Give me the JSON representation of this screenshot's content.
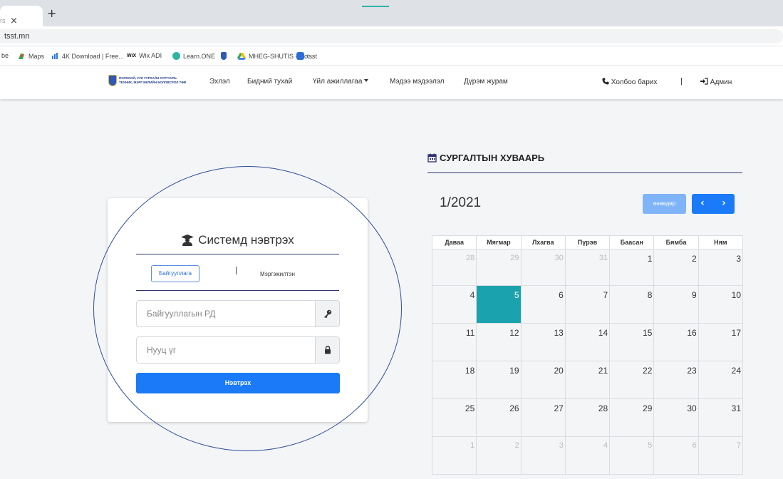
{
  "browser": {
    "tab_close": "×",
    "tab_faded": "rs",
    "new_tab": "+",
    "url": "tsst.mn",
    "bookmarks": [
      {
        "label": "be",
        "icon": "youtube-icon"
      },
      {
        "label": "Maps",
        "icon": "maps-icon",
        "color": "#34a853"
      },
      {
        "label": "4K Download | Free...",
        "icon": "4k-download-icon",
        "color": "#2b7bd6"
      },
      {
        "label": "Wix ADI",
        "icon": "wix-icon",
        "prefix": "WiX"
      },
      {
        "label": "Learn.ONE",
        "icon": "learnone-icon",
        "color": "#2fb3a9"
      },
      {
        "label": "",
        "icon": "emblem-icon",
        "color": "#2f58b8"
      },
      {
        "label": "MHEG-SHUTIS - Go...",
        "icon": "google-drive-icon"
      },
      {
        "label": "tsst",
        "icon": "tsst-icon",
        "color": "#2b6fd6"
      }
    ]
  },
  "navbar": {
    "logo_line1": "ПОЛОКОЙ, УУЛ УУРХАЙН СУРГУУЛЬ",
    "logo_line2": "ТЕХНИК, МЭРГЭЖЛИЙН БОЛОВСРОЛ ТӨВ",
    "items": [
      "Эхлэл",
      "Бидний тухай",
      "Үйл ажиллагаа",
      "Мэдээ мэдээлэл",
      "Дүрэм журам"
    ],
    "contact": "Холбоо барих",
    "separator": "|",
    "admin": "Админ"
  },
  "login": {
    "title": "Системд нэвтрэх",
    "tab_active": "Байгууллага",
    "tab_other": "Мэргэжилтэн",
    "field1_placeholder": "Байгууллагын РД",
    "field2_placeholder": "Нууц үг",
    "submit": "Нэвтрэх"
  },
  "schedule": {
    "title": "СУРГАЛТЫН ХУВААРЬ",
    "month": "1/2021",
    "today_btn": "өнөөдөр",
    "prev": "‹",
    "next": "›",
    "weekdays": [
      "Даваа",
      "Мягмар",
      "Лхагва",
      "Пүрэв",
      "Баасан",
      "Бямба",
      "Ням"
    ],
    "weeks": [
      [
        "28",
        "29",
        "30",
        "31",
        "1",
        "2",
        "3"
      ],
      [
        "4",
        "5",
        "6",
        "7",
        "8",
        "9",
        "10"
      ],
      [
        "11",
        "12",
        "13",
        "14",
        "15",
        "16",
        "17"
      ],
      [
        "18",
        "19",
        "20",
        "21",
        "22",
        "23",
        "24"
      ],
      [
        "25",
        "26",
        "27",
        "28",
        "29",
        "30",
        "31"
      ],
      [
        "1",
        "2",
        "3",
        "4",
        "5",
        "6",
        "7"
      ]
    ],
    "today_color": "#1aa3ae"
  },
  "colors": {
    "primary": "#1a7af8",
    "primary_light": "#7fb4f8",
    "rule": "#2d2f6e",
    "annotation": "#2e4d9a"
  }
}
